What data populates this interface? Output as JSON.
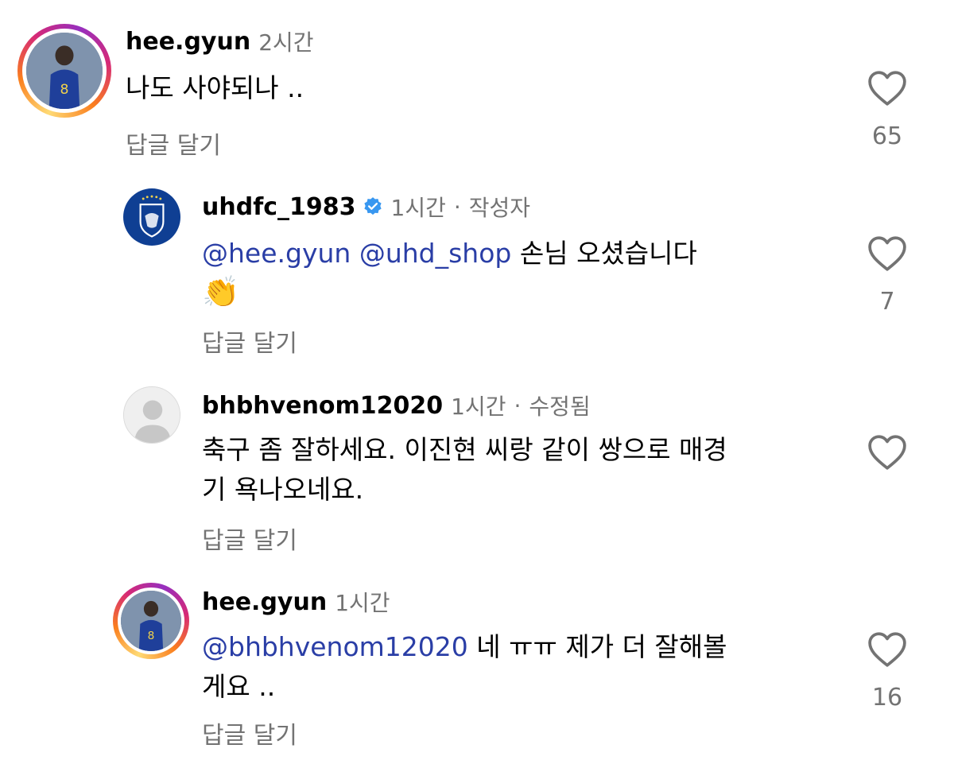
{
  "comments": [
    {
      "username": "hee.gyun",
      "time": "2시간",
      "text": "나도 사야되나 ..",
      "reply_label": "답글 달기",
      "likes": "65"
    },
    {
      "username": "uhdfc_1983",
      "time": "1시간",
      "extra": "작성자",
      "mention1": "@hee.gyun",
      "mention2": "@uhd_shop",
      "text": "손님 오셨습니다",
      "emoji": "👏",
      "reply_label": "답글 달기",
      "likes": "7"
    },
    {
      "username": "bhbhvenom12020",
      "time": "1시간",
      "extra": "수정됨",
      "text_line1": "축구 좀 잘하세요. 이진현 씨랑 같이 쌍으로 매경",
      "text_line2": "기 욕나오네요.",
      "reply_label": "답글 달기"
    },
    {
      "username": "hee.gyun",
      "time": "1시간",
      "mention": "@bhbhvenom12020",
      "text_line1_rest": "네 ㅠㅠ 제가 더 잘해볼",
      "text_line2": "게요 ..",
      "reply_label": "답글 달기",
      "likes": "16"
    }
  ],
  "separator": "·",
  "colors": {
    "mention": "#2a3ea6",
    "secondary": "#737373",
    "verified": "#3897f0",
    "club_logo": "#0f3f93"
  }
}
